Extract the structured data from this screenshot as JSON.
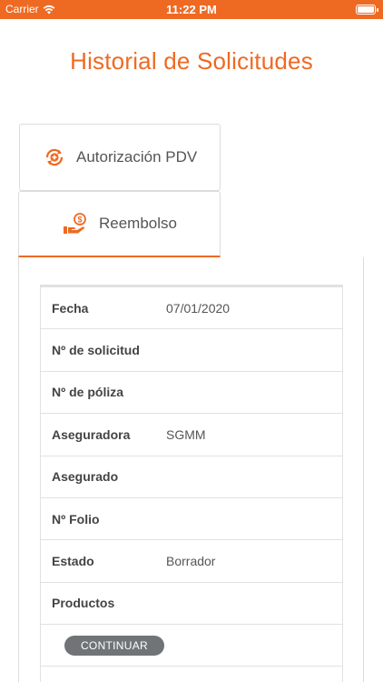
{
  "status_bar": {
    "carrier": "Carrier",
    "time": "11:22 PM"
  },
  "page": {
    "title": "Historial de Solicitudes"
  },
  "tabs": [
    {
      "label": "Autorización PDV",
      "icon": "medical-refresh-icon"
    },
    {
      "label": "Reembolso",
      "icon": "money-hand-icon",
      "selected": true
    }
  ],
  "record": {
    "rows": [
      {
        "label": "Fecha",
        "value": "07/01/2020"
      },
      {
        "label": "Nº de solicitud",
        "value": ""
      },
      {
        "label": "Nº de póliza",
        "value": ""
      },
      {
        "label": "Aseguradora",
        "value": "SGMM"
      },
      {
        "label": "Asegurado",
        "value": ""
      },
      {
        "label": "Nº Folio",
        "value": ""
      },
      {
        "label": "Estado",
        "value": "Borrador"
      },
      {
        "label": "Productos",
        "value": ""
      }
    ],
    "continue_label": "CONTINUAR"
  },
  "colors": {
    "accent": "#ee6a23",
    "button": "#707476",
    "border": "#dcdcdc"
  }
}
